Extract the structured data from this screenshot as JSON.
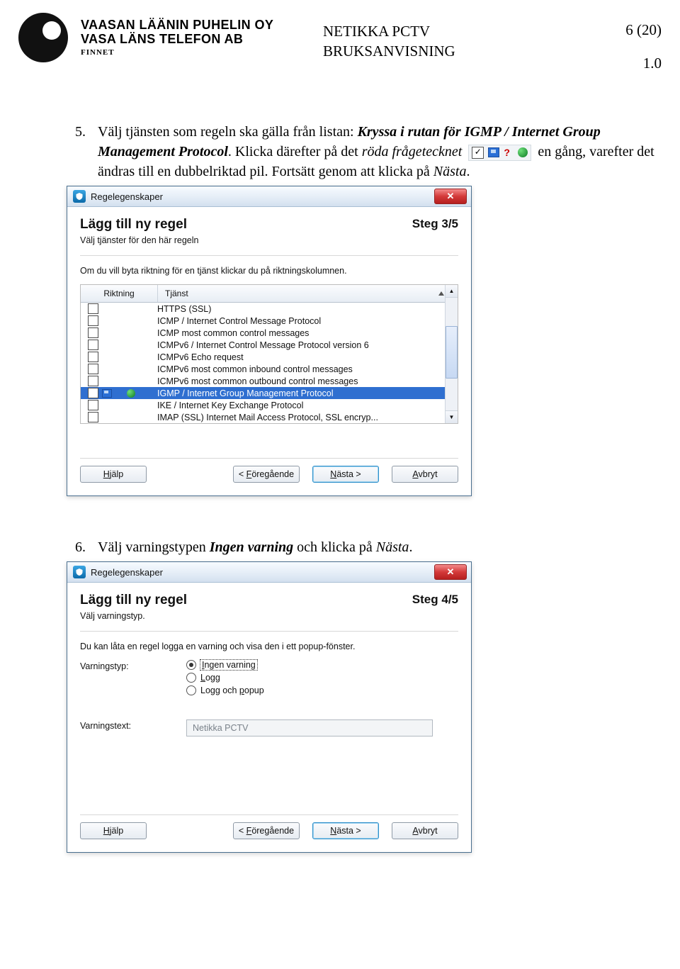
{
  "header": {
    "company_line1": "VAASAN LÄÄNIN PUHELIN OY",
    "company_line2": "VASA LÄNS TELEFON AB",
    "finnet": "FINNET",
    "center_line1": "NETIKKA PCTV",
    "center_line2": "BRUKSANVISNING",
    "pagecount": "6 (20)",
    "version": "1.0"
  },
  "step5": {
    "number": "5.",
    "text_a": "Välj tjänsten som regeln ska gälla från listan:",
    "bold_a": "Kryssa i rutan för IGMP / Internet Group Management Protocol",
    "text_b": ". Klicka därefter på det",
    "italic_b": "röda frågetecknet",
    "text_c": "en gång, varefter det ändras till en dubbelriktad pil. Fortsätt genom att klicka på",
    "italic_c": "Nästa",
    "dot": "."
  },
  "dialog1": {
    "title": "Regelegenskaper",
    "heading": "Lägg till ny regel",
    "step": "Steg 3/5",
    "sub": "Välj tjänster för den här regeln",
    "note": "Om du vill byta riktning för en tjänst klickar du på riktningskolumnen.",
    "col_dir": "Riktning",
    "col_svc": "Tjänst",
    "rows": [
      {
        "checked": false,
        "selected": false,
        "text": "HTTPS (SSL)"
      },
      {
        "checked": false,
        "selected": false,
        "text": "ICMP / Internet Control Message Protocol"
      },
      {
        "checked": false,
        "selected": false,
        "text": "ICMP most common control messages"
      },
      {
        "checked": false,
        "selected": false,
        "text": "ICMPv6 / Internet Control Message Protocol version 6"
      },
      {
        "checked": false,
        "selected": false,
        "text": "ICMPv6 Echo request"
      },
      {
        "checked": false,
        "selected": false,
        "text": "ICMPv6 most common inbound control messages"
      },
      {
        "checked": false,
        "selected": false,
        "text": "ICMPv6 most common outbound control messages"
      },
      {
        "checked": true,
        "selected": true,
        "text": "IGMP / Internet Group Management Protocol"
      },
      {
        "checked": false,
        "selected": false,
        "text": "IKE / Internet Key Exchange Protocol"
      },
      {
        "checked": false,
        "selected": false,
        "text": "IMAP (SSL) Internet Mail Access Protocol, SSL encryp..."
      }
    ],
    "btn_help": "Hjälp",
    "btn_back": "< Föregående",
    "btn_next": "Nästa >",
    "btn_cancel": "Avbryt",
    "help_accel": "H",
    "back_accel": "F",
    "next_accel": "N",
    "cancel_accel": "A"
  },
  "step6": {
    "number": "6.",
    "text_a": "Välj varningstypen",
    "bold_a": "Ingen varning",
    "text_b": "och klicka på",
    "italic_b": "Nästa",
    "dot": "."
  },
  "dialog2": {
    "title": "Regelegenskaper",
    "heading": "Lägg till ny regel",
    "step": "Steg 4/5",
    "sub": "Välj varningstyp.",
    "note": "Du kan låta en regel logga en varning och visa den i ett popup-fönster.",
    "lbl_type": "Varningstyp:",
    "radios": [
      {
        "label": "Ingen varning",
        "checked": true,
        "accel": "I"
      },
      {
        "label": "Logg",
        "checked": false,
        "accel": "L"
      },
      {
        "label": "Logg och popup",
        "checked": false,
        "accel": "p"
      }
    ],
    "lbl_text": "Varningstext:",
    "textvalue": "Netikka PCTV",
    "btn_help": "Hjälp",
    "btn_back": "< Föregående",
    "btn_next": "Nästa >",
    "btn_cancel": "Avbryt"
  }
}
